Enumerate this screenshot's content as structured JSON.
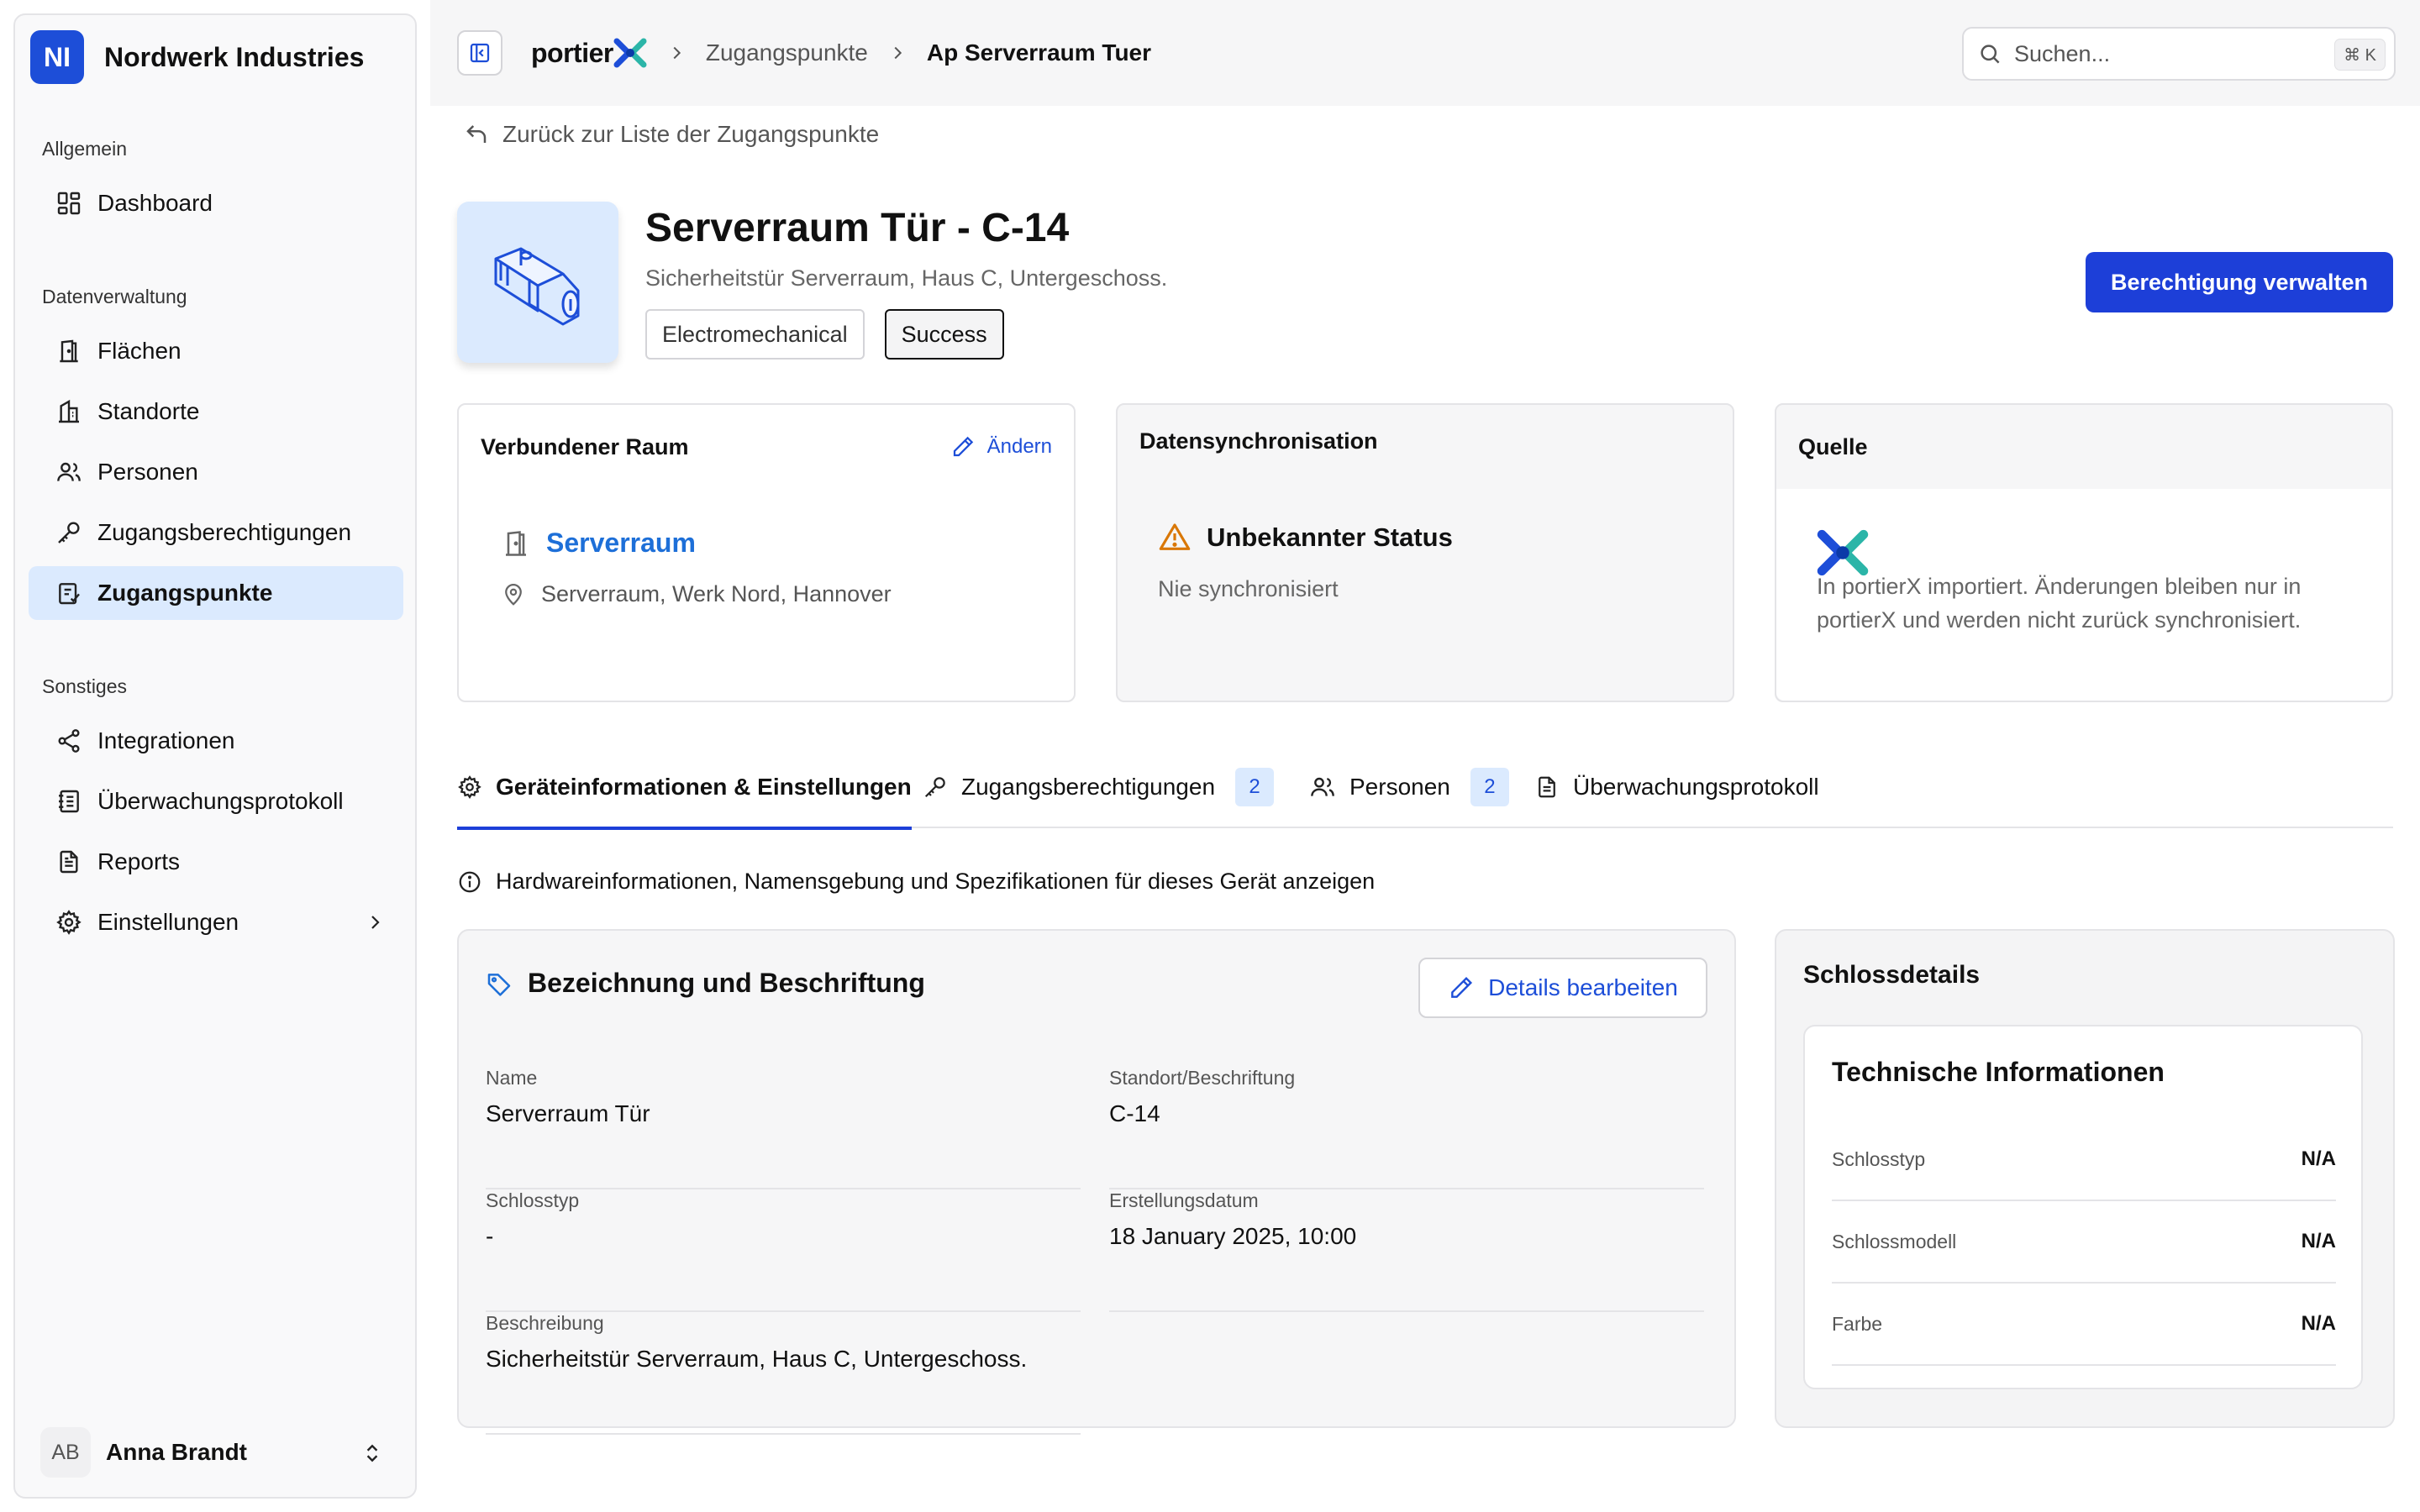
{
  "org": {
    "initials": "NI",
    "name": "Nordwerk Industries",
    "accent": "#1d4ed8"
  },
  "sidebar": {
    "groups": [
      {
        "label": "Allgemein"
      },
      {
        "label": "Datenverwaltung"
      },
      {
        "label": "Sonstiges"
      }
    ],
    "items": [
      {
        "label": "Dashboard",
        "icon": "dashboard-icon"
      },
      {
        "label": "Flächen",
        "icon": "door-icon"
      },
      {
        "label": "Standorte",
        "icon": "building-icon"
      },
      {
        "label": "Personen",
        "icon": "users-icon"
      },
      {
        "label": "Zugangsberechtigungen",
        "icon": "key-icon"
      },
      {
        "label": "Zugangspunkte",
        "icon": "access-point-icon",
        "active": true
      },
      {
        "label": "Integrationen",
        "icon": "share-icon"
      },
      {
        "label": "Überwachungsprotokoll",
        "icon": "log-icon"
      },
      {
        "label": "Reports",
        "icon": "report-icon"
      },
      {
        "label": "Einstellungen",
        "icon": "gear-icon"
      }
    ],
    "user": {
      "initials": "AB",
      "name": "Anna Brandt"
    }
  },
  "topbar": {
    "logo_text": "portier",
    "breadcrumbs": [
      "Zugangspunkte",
      "Ap Serverraum Tuer"
    ],
    "search": {
      "placeholder": "Suchen...",
      "shortcut": "⌘ K"
    }
  },
  "page": {
    "back_label": "Zurück zur Liste der Zugangspunkte",
    "title": "Serverraum Tür - C-14",
    "subtitle": "Sicherheitstür Serverraum, Haus C, Untergeschoss.",
    "tags": [
      "Electromechanical",
      "Success"
    ],
    "primary_action": "Berechtigung verwalten"
  },
  "cards": {
    "room": {
      "title": "Verbundener Raum",
      "edit_label": "Ändern",
      "room_name": "Serverraum",
      "location": "Serverraum, Werk Nord, Hannover"
    },
    "sync": {
      "title": "Datensynchronisation",
      "status": "Unbekannter Status",
      "sub": "Nie synchronisiert",
      "warning_color": "#d97706"
    },
    "source": {
      "title": "Quelle",
      "text": "In portierX importiert. Änderungen bleiben nur in portierX und werden nicht zurück synchronisiert."
    }
  },
  "tabs": [
    {
      "label": "Geräteinformationen & Einstellungen",
      "icon": "gear-icon",
      "active": true
    },
    {
      "label": "Zugangsberechtigungen",
      "icon": "key-icon",
      "count": "2"
    },
    {
      "label": "Personen",
      "icon": "users-icon",
      "count": "2"
    },
    {
      "label": "Überwachungsprotokoll",
      "icon": "document-icon"
    }
  ],
  "info_text": "Hardwareinformationen, Namensgebung und Spezifikationen für dieses Gerät anzeigen",
  "details": {
    "title": "Bezeichnung und Beschriftung",
    "edit_label": "Details bearbeiten",
    "fields": [
      {
        "label": "Name",
        "value": "Serverraum Tür"
      },
      {
        "label": "Standort/Beschriftung",
        "value": "C-14"
      },
      {
        "label": "Schlosstyp",
        "value": "-"
      },
      {
        "label": "Erstellungsdatum",
        "value": "18 January 2025, 10:00"
      },
      {
        "label": "Beschreibung",
        "value": "Sicherheitstür Serverraum, Haus C, Untergeschoss."
      }
    ]
  },
  "lock": {
    "title": "Schlossdetails",
    "inner_title": "Technische Informationen",
    "rows": [
      {
        "key": "Schlosstyp",
        "value": "N/A"
      },
      {
        "key": "Schlossmodell",
        "value": "N/A"
      },
      {
        "key": "Farbe",
        "value": "N/A"
      }
    ]
  }
}
